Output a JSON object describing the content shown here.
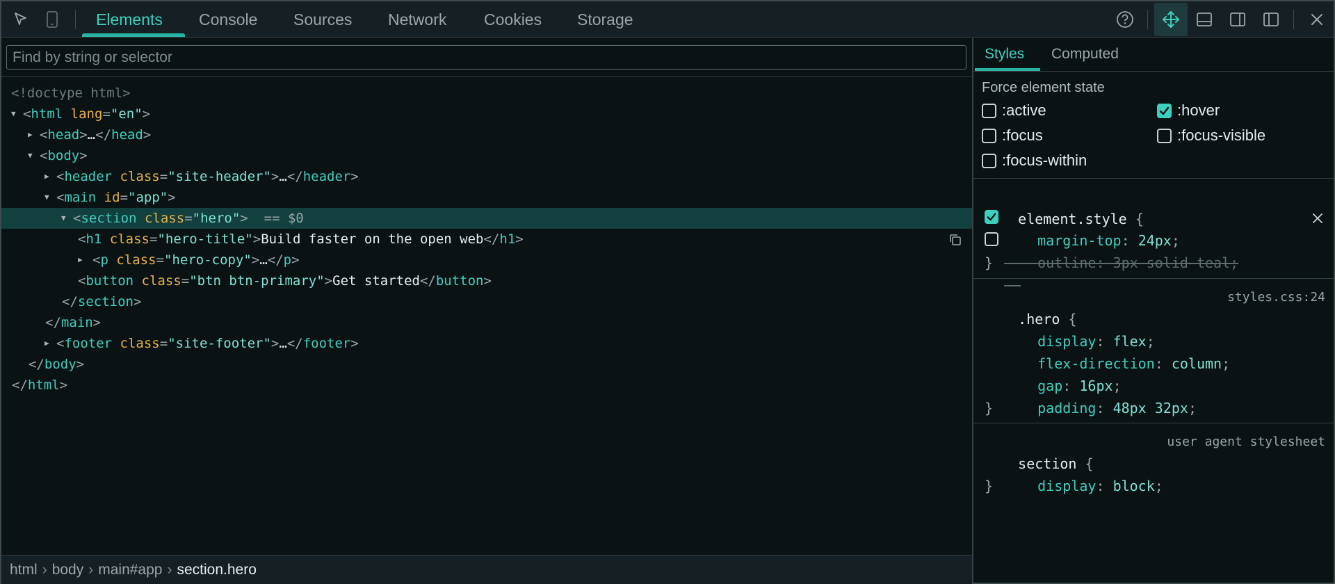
{
  "toolbar": {
    "tabs": [
      {
        "label": "Elements",
        "active": true
      },
      {
        "label": "Console"
      },
      {
        "label": "Sources"
      },
      {
        "label": "Network"
      },
      {
        "label": "Cookies"
      },
      {
        "label": "Storage"
      }
    ],
    "icons": [
      "select-element-icon",
      "device-toolbar-icon",
      "help-icon",
      "move-dock-icon",
      "dock-bottom-icon",
      "dock-right-icon",
      "dock-left-icon",
      "close-icon"
    ]
  },
  "elements": {
    "search_placeholder": "Find by string or selector",
    "tree": [
      {
        "code": "<!doctype html>"
      },
      {
        "tag": "html",
        "attr": "lang",
        "val": "\"en\""
      },
      {
        "tag": "head",
        "ellipsis": "…"
      },
      {
        "tag": "body"
      },
      {
        "tag": "header",
        "attr": "class",
        "val": "\"site-header\"",
        "ellipsis": "…"
      },
      {
        "tag": "main",
        "attr": "id",
        "val": "\"app\""
      },
      {
        "tag": "section",
        "attr": "class",
        "val": "\"hero\"",
        "ref": "== $0",
        "selected": true
      },
      {
        "tag": "h1",
        "attr": "class",
        "val": "\"hero-title\"",
        "text": "Build faster on the open web"
      },
      {
        "tag": "p",
        "attr": "class",
        "val": "\"hero-copy\"",
        "ellipsis": "…"
      },
      {
        "tag": "button",
        "attr": "class",
        "val": "\"btn btn-primary\"",
        "text": "Get started"
      },
      {
        "close": "section"
      },
      {
        "close": "main"
      },
      {
        "tag": "footer",
        "attr": "class",
        "val": "\"site-footer\"",
        "ellipsis": "…"
      },
      {
        "close": "body"
      },
      {
        "close": "html"
      }
    ],
    "breadcrumb": [
      "html",
      "body",
      "main#app",
      "section.hero"
    ]
  },
  "styles": {
    "tabs": [
      {
        "label": "Styles",
        "active": true
      },
      {
        "label": "Computed"
      }
    ],
    "force_state_title": "Force element state",
    "states": [
      {
        "label": ":active",
        "checked": false
      },
      {
        "label": ":hover",
        "checked": true
      },
      {
        "label": ":focus",
        "checked": false
      },
      {
        "label": ":focus-visible",
        "checked": false
      },
      {
        "label": ":focus-within",
        "checked": false
      }
    ],
    "element_style": {
      "selector": "element.style",
      "props": [
        {
          "name": "margin-top",
          "value": "24px",
          "enabled": true
        },
        {
          "name": "outline",
          "value": "3px solid teal",
          "enabled": false
        }
      ]
    },
    "hero_rule": {
      "selector": ".hero",
      "source": "styles.css:24",
      "props": [
        {
          "name": "display",
          "value": "flex"
        },
        {
          "name": "flex-direction",
          "value": "column"
        },
        {
          "name": "gap",
          "value": "16px"
        },
        {
          "name": "padding",
          "value": "48px 32px"
        }
      ]
    },
    "section_rule": {
      "selector": "section",
      "source": "user agent stylesheet",
      "props": [
        {
          "name": "display",
          "value": "block"
        }
      ]
    },
    "brace_open": "{",
    "brace_close": "}",
    "colon": ":",
    "semicolon": ";"
  },
  "colors": {
    "accent": "#3fcfbf",
    "selection": "#12403f",
    "background": "#0a1214"
  }
}
